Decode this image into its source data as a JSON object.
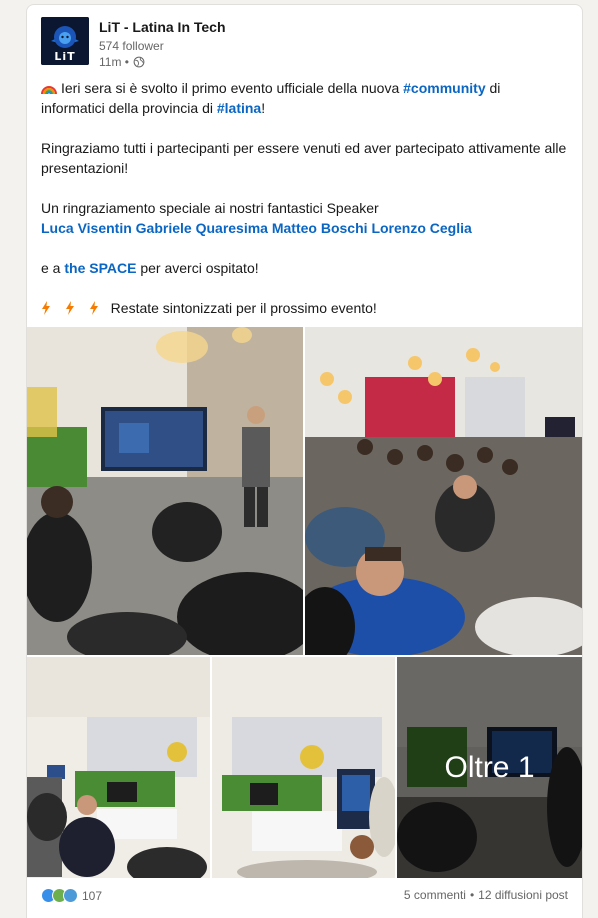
{
  "post": {
    "org_name": "LiT - Latina In Tech",
    "logo_text": "LiT",
    "followers": "574 follower",
    "time": "11m •",
    "line1_pre": "Ieri sera si è svolto il primo evento ufficiale della nuova ",
    "tag_community": "#community",
    "line1_post": " di",
    "line2_pre": "informatici della provincia di ",
    "tag_latina": "#latina",
    "line2_post": "!",
    "para2": "Ringraziamo tutti i partecipanti per essere venuti ed aver partecipato attivamente alle presentazioni!",
    "para3": "Un ringraziamento speciale ai nostri fantastici Speaker",
    "speakers": [
      "Luca Visentin",
      "Gabriele Quaresima",
      "Matteo Boschi",
      "Lorenzo Ceglia"
    ],
    "para4_pre": "e a ",
    "space_mention": "the SPACE",
    "para4_post": " per averci ospitato!",
    "para5": "Restate sintonizzati per il prossimo evento!",
    "emoji_rainbow": "rainbow-icon",
    "emoji_bolt": "lightning-icon"
  },
  "photos": {
    "more_label": "Oltre 1"
  },
  "social": {
    "reaction_count": "107",
    "comments": "5 commenti",
    "separator": "•",
    "shares": "12 diffusioni post"
  },
  "colors": {
    "link": "#0a66c2",
    "like": "#378fe9",
    "celebrate": "#6dae4f",
    "support": "#4c9ad8"
  }
}
